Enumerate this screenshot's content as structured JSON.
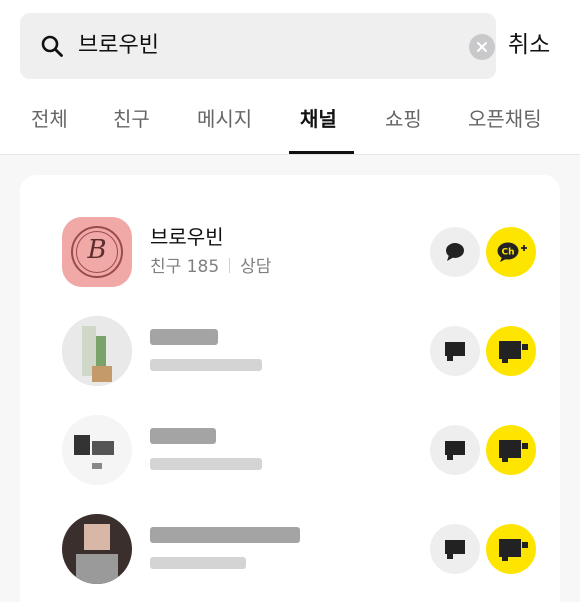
{
  "search": {
    "query": "브로우빈",
    "cancel_label": "취소"
  },
  "tabs": [
    {
      "label": "전체",
      "active": false
    },
    {
      "label": "친구",
      "active": false
    },
    {
      "label": "메시지",
      "active": false
    },
    {
      "label": "채널",
      "active": true
    },
    {
      "label": "쇼핑",
      "active": false
    },
    {
      "label": "오픈채팅",
      "active": false
    }
  ],
  "results": {
    "channel": {
      "name": "브로우빈",
      "friends": "친구 185",
      "consult": "상담",
      "logo_letter": "B",
      "chat_icon": "speech-bubble-icon",
      "add_icon": "ch-plus-icon"
    }
  },
  "colors": {
    "accent": "#fee500",
    "logo_bg": "#f0a9a7"
  }
}
